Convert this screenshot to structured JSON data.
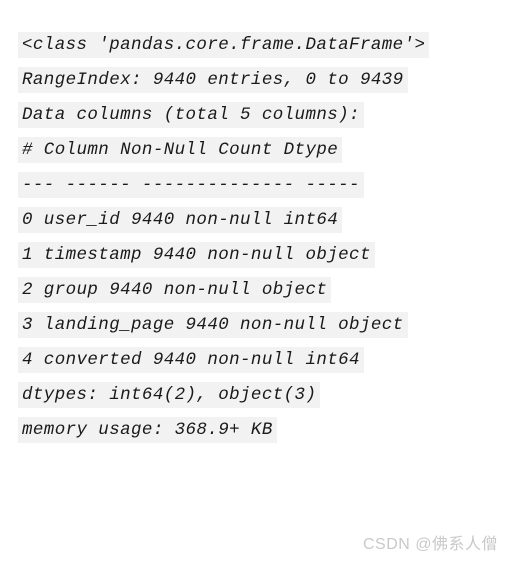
{
  "output": {
    "kind": "pandas-dataframe-info",
    "lines": [
      "<class 'pandas.core.frame.DataFrame'>",
      "RangeIndex: 9440 entries, 0 to 9439",
      "Data columns (total 5 columns):",
      "# Column Non-Null Count Dtype",
      "--- ------ -------------- -----",
      "0 user_id 9440 non-null int64",
      "1 timestamp 9440 non-null object",
      "2 group 9440 non-null object",
      "3 landing_page 9440 non-null object",
      "4 converted 9440 non-null int64",
      "dtypes: int64(2), object(3)",
      "memory usage: 368.9+ KB"
    ],
    "header": {
      "class_repr": "<class 'pandas.core.frame.DataFrame'>",
      "range_index": "RangeIndex: 9440 entries, 0 to 9439",
      "data_columns": "Data columns (total 5 columns):"
    },
    "table": {
      "columns": [
        "#",
        "Column",
        "Non-Null Count",
        "Dtype"
      ],
      "separator": "--- ------ -------------- -----",
      "rows": [
        {
          "index": "0",
          "column": "user_id",
          "non_null_count": "9440 non-null",
          "dtype": "int64"
        },
        {
          "index": "1",
          "column": "timestamp",
          "non_null_count": "9440 non-null",
          "dtype": "object"
        },
        {
          "index": "2",
          "column": "group",
          "non_null_count": "9440 non-null",
          "dtype": "object"
        },
        {
          "index": "3",
          "column": "landing_page",
          "non_null_count": "9440 non-null",
          "dtype": "object"
        },
        {
          "index": "4",
          "column": "converted",
          "non_null_count": "9440 non-null",
          "dtype": "int64"
        }
      ]
    },
    "footer": {
      "dtypes": "dtypes: int64(2), object(3)",
      "memory_usage": "memory usage: 368.9+ KB"
    },
    "entries": "9440",
    "total_columns": "5",
    "highlight_color": "#f2f2f2",
    "text_color": "#1a1a1a"
  },
  "watermark": {
    "text": "CSDN @佛系人僧",
    "color": "#c9c9c9"
  }
}
